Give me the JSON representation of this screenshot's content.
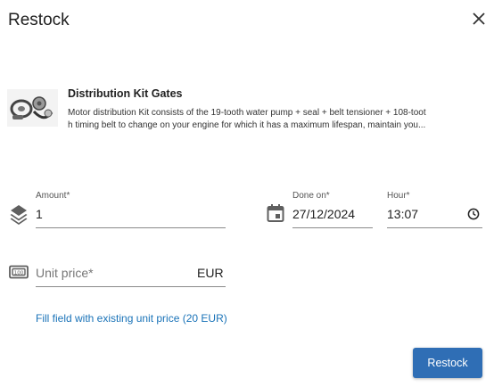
{
  "dialog": {
    "title": "Restock",
    "close_icon": "close-icon"
  },
  "product": {
    "name": "Distribution Kit Gates",
    "description_line1": "Motor distribution Kit consists of the 19-tooth water pump + seal + belt tensioner + 108-toot",
    "description_line2": "h timing belt to change on your engine for which it has a maximum lifespan, maintain you..."
  },
  "form": {
    "amount": {
      "label": "Amount*",
      "value": "1",
      "icon": "layers-icon"
    },
    "done_on": {
      "label": "Done on*",
      "value": "27/12/2024",
      "icon": "calendar-icon"
    },
    "hour": {
      "label": "Hour*",
      "value": "13:07",
      "icon": "clock-icon"
    },
    "unit_price": {
      "placeholder": "Unit price*",
      "suffix": "EUR",
      "icon": "banknote-icon"
    },
    "fill_link": "Fill field with existing unit price (20 EUR)"
  },
  "actions": {
    "restock_label": "Restock"
  },
  "colors": {
    "primary": "#2f6eb5",
    "link": "#1a73b8"
  }
}
